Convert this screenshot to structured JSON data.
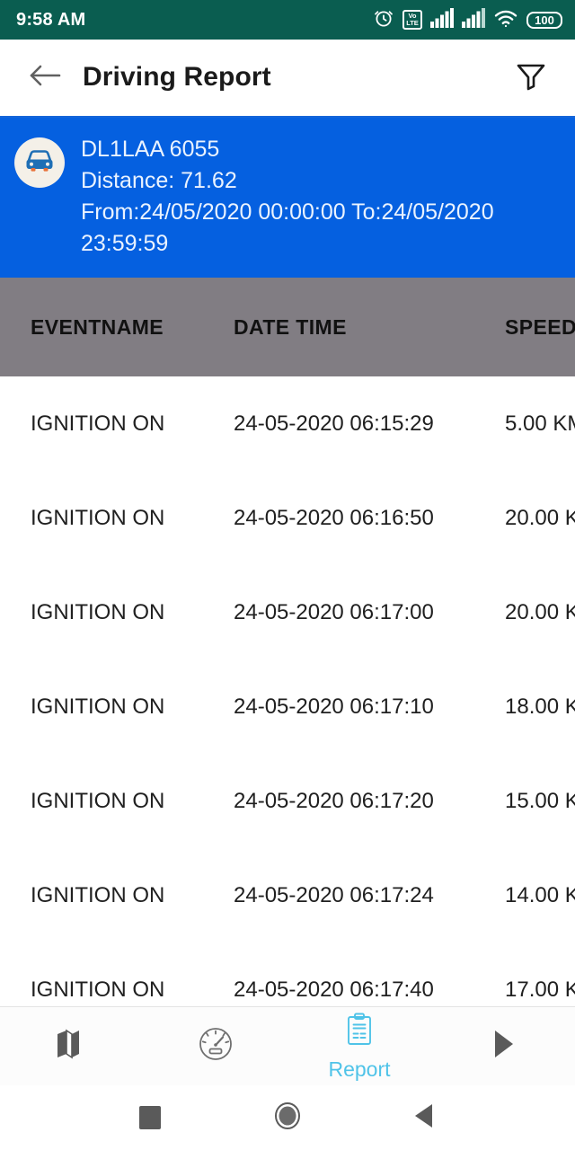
{
  "status_bar": {
    "time": "9:58 AM",
    "battery_level": "100",
    "volte_top": "Vo",
    "volte_bottom": "LTE",
    "background_color": "#0a5d50",
    "icons": [
      "alarm-icon",
      "volte-icon",
      "signal-icon",
      "signal-icon",
      "wifi-icon",
      "battery-icon"
    ]
  },
  "app_bar": {
    "title": "Driving Report",
    "back_icon": "back-arrow-icon",
    "filter_icon": "filter-funnel-icon"
  },
  "vehicle_card": {
    "background_color": "#0560e0",
    "avatar_icon": "car-icon",
    "vehicle_number": "DL1LAA 6055",
    "distance": "Distance: 71.62",
    "date_range": "From:24/05/2020 00:00:00 To:24/05/2020\n23:59:59"
  },
  "table": {
    "header_background": "#817d83",
    "columns": [
      "EVENTNAME",
      "DATE TIME",
      "SPEED"
    ],
    "rows": [
      {
        "eventname": "IGNITION ON",
        "datetime": "24-05-2020 06:15:29",
        "speed": "5.00 KM"
      },
      {
        "eventname": "IGNITION ON",
        "datetime": "24-05-2020 06:16:50",
        "speed": "20.00 K"
      },
      {
        "eventname": "IGNITION ON",
        "datetime": "24-05-2020 06:17:00",
        "speed": "20.00 K"
      },
      {
        "eventname": "IGNITION ON",
        "datetime": "24-05-2020 06:17:10",
        "speed": "18.00 K"
      },
      {
        "eventname": "IGNITION ON",
        "datetime": "24-05-2020 06:17:20",
        "speed": "15.00 K"
      },
      {
        "eventname": "IGNITION ON",
        "datetime": "24-05-2020 06:17:24",
        "speed": "14.00 K"
      },
      {
        "eventname": "IGNITION ON",
        "datetime": "24-05-2020 06:17:40",
        "speed": "17.00 K"
      }
    ]
  },
  "bottom_nav": {
    "active_color": "#4fc3e8",
    "inactive_color": "#5a5a5a",
    "items": [
      {
        "icon": "map-icon",
        "label": ""
      },
      {
        "icon": "speedometer-icon",
        "label": ""
      },
      {
        "icon": "clipboard-report-icon",
        "label": "Report"
      },
      {
        "icon": "play-triangle-icon",
        "label": ""
      }
    ]
  },
  "system_nav": {
    "recents_icon": "square-recents-icon",
    "home_icon": "circle-home-icon",
    "back_icon": "triangle-back-icon"
  }
}
